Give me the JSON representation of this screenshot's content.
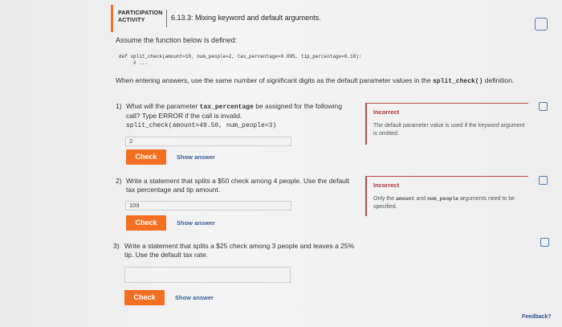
{
  "activity": {
    "label": "PARTICIPATION ACTIVITY",
    "title": "6.13.3: Mixing keyword and default arguments."
  },
  "intro": "Assume the function below is defined:",
  "code": {
    "line1": "def split_check(amount=10, num_people=2, tax_percentage=0.095, tip_percentage=0.18):",
    "line2": "# ..."
  },
  "instructions": {
    "before": "When entering answers, use the same number of significant digits as the default parameter values in the ",
    "func": "split_check()",
    "after": " definition."
  },
  "questions": [
    {
      "number": "1)",
      "text_before": "What will the parameter ",
      "param": "tax_percentage",
      "text_after": " be assigned for the following call? Type ERROR if the call is invalid.",
      "code": "split_check(amount=49.50, num_people=3)",
      "answer": "2",
      "check_label": "Check",
      "show_answer_label": "Show answer",
      "feedback_title": "Incorrect",
      "feedback_text": "The default parameter value is used if the keyword argument is omitted."
    },
    {
      "number": "2)",
      "text": "Write a statement that splits a $50 check among 4 people. Use the default tax percentage and tip amount.",
      "answer": "109",
      "check_label": "Check",
      "show_answer_label": "Show answer",
      "feedback_title": "Incorrect",
      "feedback_before": "Only the ",
      "feedback_mono1": "amount",
      "feedback_mid": " and ",
      "feedback_mono2": "num_people",
      "feedback_after": " arguments need to be specified."
    },
    {
      "number": "3)",
      "text": "Write a statement that splits a $25 check among 3 people and leaves a 25% tip. Use the default tax rate.",
      "answer": "",
      "check_label": "Check",
      "show_answer_label": "Show answer"
    }
  ],
  "feedback_link": "Feedback?",
  "colors": {
    "accent": "#f36f21",
    "incorrect": "#b94a48",
    "checkbox": "#4a7fbf",
    "link": "#3a5f99"
  }
}
